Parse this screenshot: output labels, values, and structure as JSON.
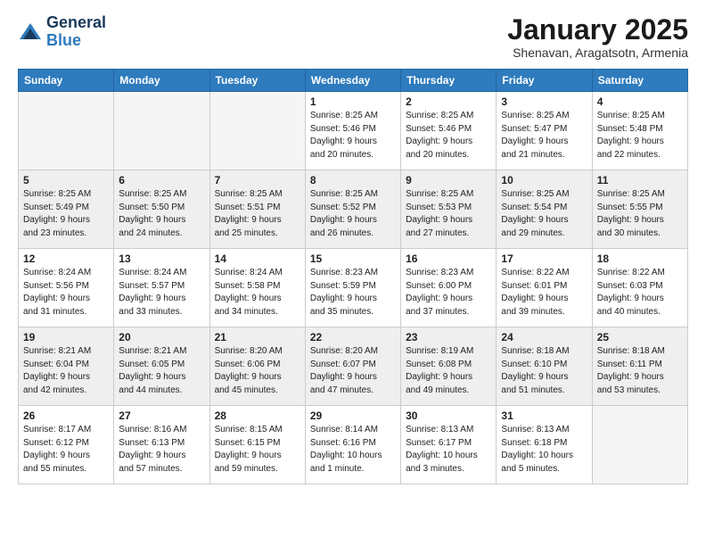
{
  "logo": {
    "general": "General",
    "blue": "Blue"
  },
  "header": {
    "month": "January 2025",
    "location": "Shenavan, Aragatsotn, Armenia"
  },
  "weekdays": [
    "Sunday",
    "Monday",
    "Tuesday",
    "Wednesday",
    "Thursday",
    "Friday",
    "Saturday"
  ],
  "weeks": [
    [
      {
        "day": "",
        "info": ""
      },
      {
        "day": "",
        "info": ""
      },
      {
        "day": "",
        "info": ""
      },
      {
        "day": "1",
        "info": "Sunrise: 8:25 AM\nSunset: 5:46 PM\nDaylight: 9 hours\nand 20 minutes."
      },
      {
        "day": "2",
        "info": "Sunrise: 8:25 AM\nSunset: 5:46 PM\nDaylight: 9 hours\nand 20 minutes."
      },
      {
        "day": "3",
        "info": "Sunrise: 8:25 AM\nSunset: 5:47 PM\nDaylight: 9 hours\nand 21 minutes."
      },
      {
        "day": "4",
        "info": "Sunrise: 8:25 AM\nSunset: 5:48 PM\nDaylight: 9 hours\nand 22 minutes."
      }
    ],
    [
      {
        "day": "5",
        "info": "Sunrise: 8:25 AM\nSunset: 5:49 PM\nDaylight: 9 hours\nand 23 minutes."
      },
      {
        "day": "6",
        "info": "Sunrise: 8:25 AM\nSunset: 5:50 PM\nDaylight: 9 hours\nand 24 minutes."
      },
      {
        "day": "7",
        "info": "Sunrise: 8:25 AM\nSunset: 5:51 PM\nDaylight: 9 hours\nand 25 minutes."
      },
      {
        "day": "8",
        "info": "Sunrise: 8:25 AM\nSunset: 5:52 PM\nDaylight: 9 hours\nand 26 minutes."
      },
      {
        "day": "9",
        "info": "Sunrise: 8:25 AM\nSunset: 5:53 PM\nDaylight: 9 hours\nand 27 minutes."
      },
      {
        "day": "10",
        "info": "Sunrise: 8:25 AM\nSunset: 5:54 PM\nDaylight: 9 hours\nand 29 minutes."
      },
      {
        "day": "11",
        "info": "Sunrise: 8:25 AM\nSunset: 5:55 PM\nDaylight: 9 hours\nand 30 minutes."
      }
    ],
    [
      {
        "day": "12",
        "info": "Sunrise: 8:24 AM\nSunset: 5:56 PM\nDaylight: 9 hours\nand 31 minutes."
      },
      {
        "day": "13",
        "info": "Sunrise: 8:24 AM\nSunset: 5:57 PM\nDaylight: 9 hours\nand 33 minutes."
      },
      {
        "day": "14",
        "info": "Sunrise: 8:24 AM\nSunset: 5:58 PM\nDaylight: 9 hours\nand 34 minutes."
      },
      {
        "day": "15",
        "info": "Sunrise: 8:23 AM\nSunset: 5:59 PM\nDaylight: 9 hours\nand 35 minutes."
      },
      {
        "day": "16",
        "info": "Sunrise: 8:23 AM\nSunset: 6:00 PM\nDaylight: 9 hours\nand 37 minutes."
      },
      {
        "day": "17",
        "info": "Sunrise: 8:22 AM\nSunset: 6:01 PM\nDaylight: 9 hours\nand 39 minutes."
      },
      {
        "day": "18",
        "info": "Sunrise: 8:22 AM\nSunset: 6:03 PM\nDaylight: 9 hours\nand 40 minutes."
      }
    ],
    [
      {
        "day": "19",
        "info": "Sunrise: 8:21 AM\nSunset: 6:04 PM\nDaylight: 9 hours\nand 42 minutes."
      },
      {
        "day": "20",
        "info": "Sunrise: 8:21 AM\nSunset: 6:05 PM\nDaylight: 9 hours\nand 44 minutes."
      },
      {
        "day": "21",
        "info": "Sunrise: 8:20 AM\nSunset: 6:06 PM\nDaylight: 9 hours\nand 45 minutes."
      },
      {
        "day": "22",
        "info": "Sunrise: 8:20 AM\nSunset: 6:07 PM\nDaylight: 9 hours\nand 47 minutes."
      },
      {
        "day": "23",
        "info": "Sunrise: 8:19 AM\nSunset: 6:08 PM\nDaylight: 9 hours\nand 49 minutes."
      },
      {
        "day": "24",
        "info": "Sunrise: 8:18 AM\nSunset: 6:10 PM\nDaylight: 9 hours\nand 51 minutes."
      },
      {
        "day": "25",
        "info": "Sunrise: 8:18 AM\nSunset: 6:11 PM\nDaylight: 9 hours\nand 53 minutes."
      }
    ],
    [
      {
        "day": "26",
        "info": "Sunrise: 8:17 AM\nSunset: 6:12 PM\nDaylight: 9 hours\nand 55 minutes."
      },
      {
        "day": "27",
        "info": "Sunrise: 8:16 AM\nSunset: 6:13 PM\nDaylight: 9 hours\nand 57 minutes."
      },
      {
        "day": "28",
        "info": "Sunrise: 8:15 AM\nSunset: 6:15 PM\nDaylight: 9 hours\nand 59 minutes."
      },
      {
        "day": "29",
        "info": "Sunrise: 8:14 AM\nSunset: 6:16 PM\nDaylight: 10 hours\nand 1 minute."
      },
      {
        "day": "30",
        "info": "Sunrise: 8:13 AM\nSunset: 6:17 PM\nDaylight: 10 hours\nand 3 minutes."
      },
      {
        "day": "31",
        "info": "Sunrise: 8:13 AM\nSunset: 6:18 PM\nDaylight: 10 hours\nand 5 minutes."
      },
      {
        "day": "",
        "info": ""
      }
    ]
  ]
}
